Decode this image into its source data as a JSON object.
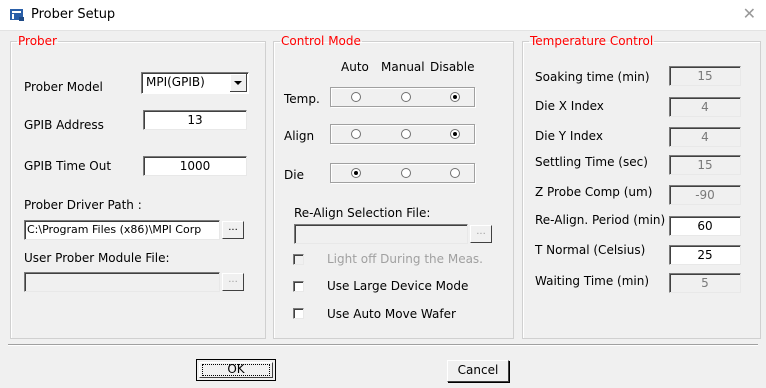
{
  "window": {
    "title": "Prober Setup",
    "icon": "app-icon",
    "close": "✕"
  },
  "prober": {
    "legend": "Prober",
    "model_label": "Prober Model",
    "model_value": "MPI(GPIB)",
    "gpib_address_label": "GPIB Address",
    "gpib_address_value": "13",
    "gpib_timeout_label": "GPIB Time Out",
    "gpib_timeout_value": "1000",
    "driver_path_label": "Prober Driver Path :",
    "driver_path_value": "C:\\Program Files (x86)\\MPI Corp",
    "browse_label": "...",
    "user_module_label": "User Prober Module File:",
    "user_module_value": ""
  },
  "control": {
    "legend": "Control Mode",
    "col_auto": "Auto",
    "col_manual": "Manual",
    "col_disable": "Disable",
    "rows": [
      {
        "label": "Temp.",
        "selected": "disable"
      },
      {
        "label": "Align",
        "selected": "disable"
      },
      {
        "label": "Die",
        "selected": "auto"
      }
    ],
    "realign_label": "Re-Align Selection File:",
    "realign_value": "",
    "browse_label": "...",
    "light_off_label": "Light off During the Meas.",
    "large_device_label": "Use Large Device Mode",
    "auto_move_label": "Use Auto Move Wafer"
  },
  "temperature": {
    "legend": "Temperature Control",
    "soaking_label": "Soaking time (min)",
    "soaking_value": "15",
    "die_x_label": "Die X Index",
    "die_x_value": "4",
    "die_y_label": "Die Y Index",
    "die_y_value": "4",
    "settling_label": "Settling Time (sec)",
    "settling_value": "15",
    "zprobe_label": "Z Probe Comp (um)",
    "zprobe_value": "-90",
    "realign_period_label": "Re-Align. Period (min)",
    "realign_period_value": "60",
    "tnormal_label": "T Normal (Celsius)",
    "tnormal_value": "25",
    "waiting_label": "Waiting Time (min)",
    "waiting_value": "5"
  },
  "buttons": {
    "ok": "OK",
    "cancel": "Cancel"
  },
  "colors": {
    "legend": "#ff0000",
    "background": "#f0f0f0"
  }
}
